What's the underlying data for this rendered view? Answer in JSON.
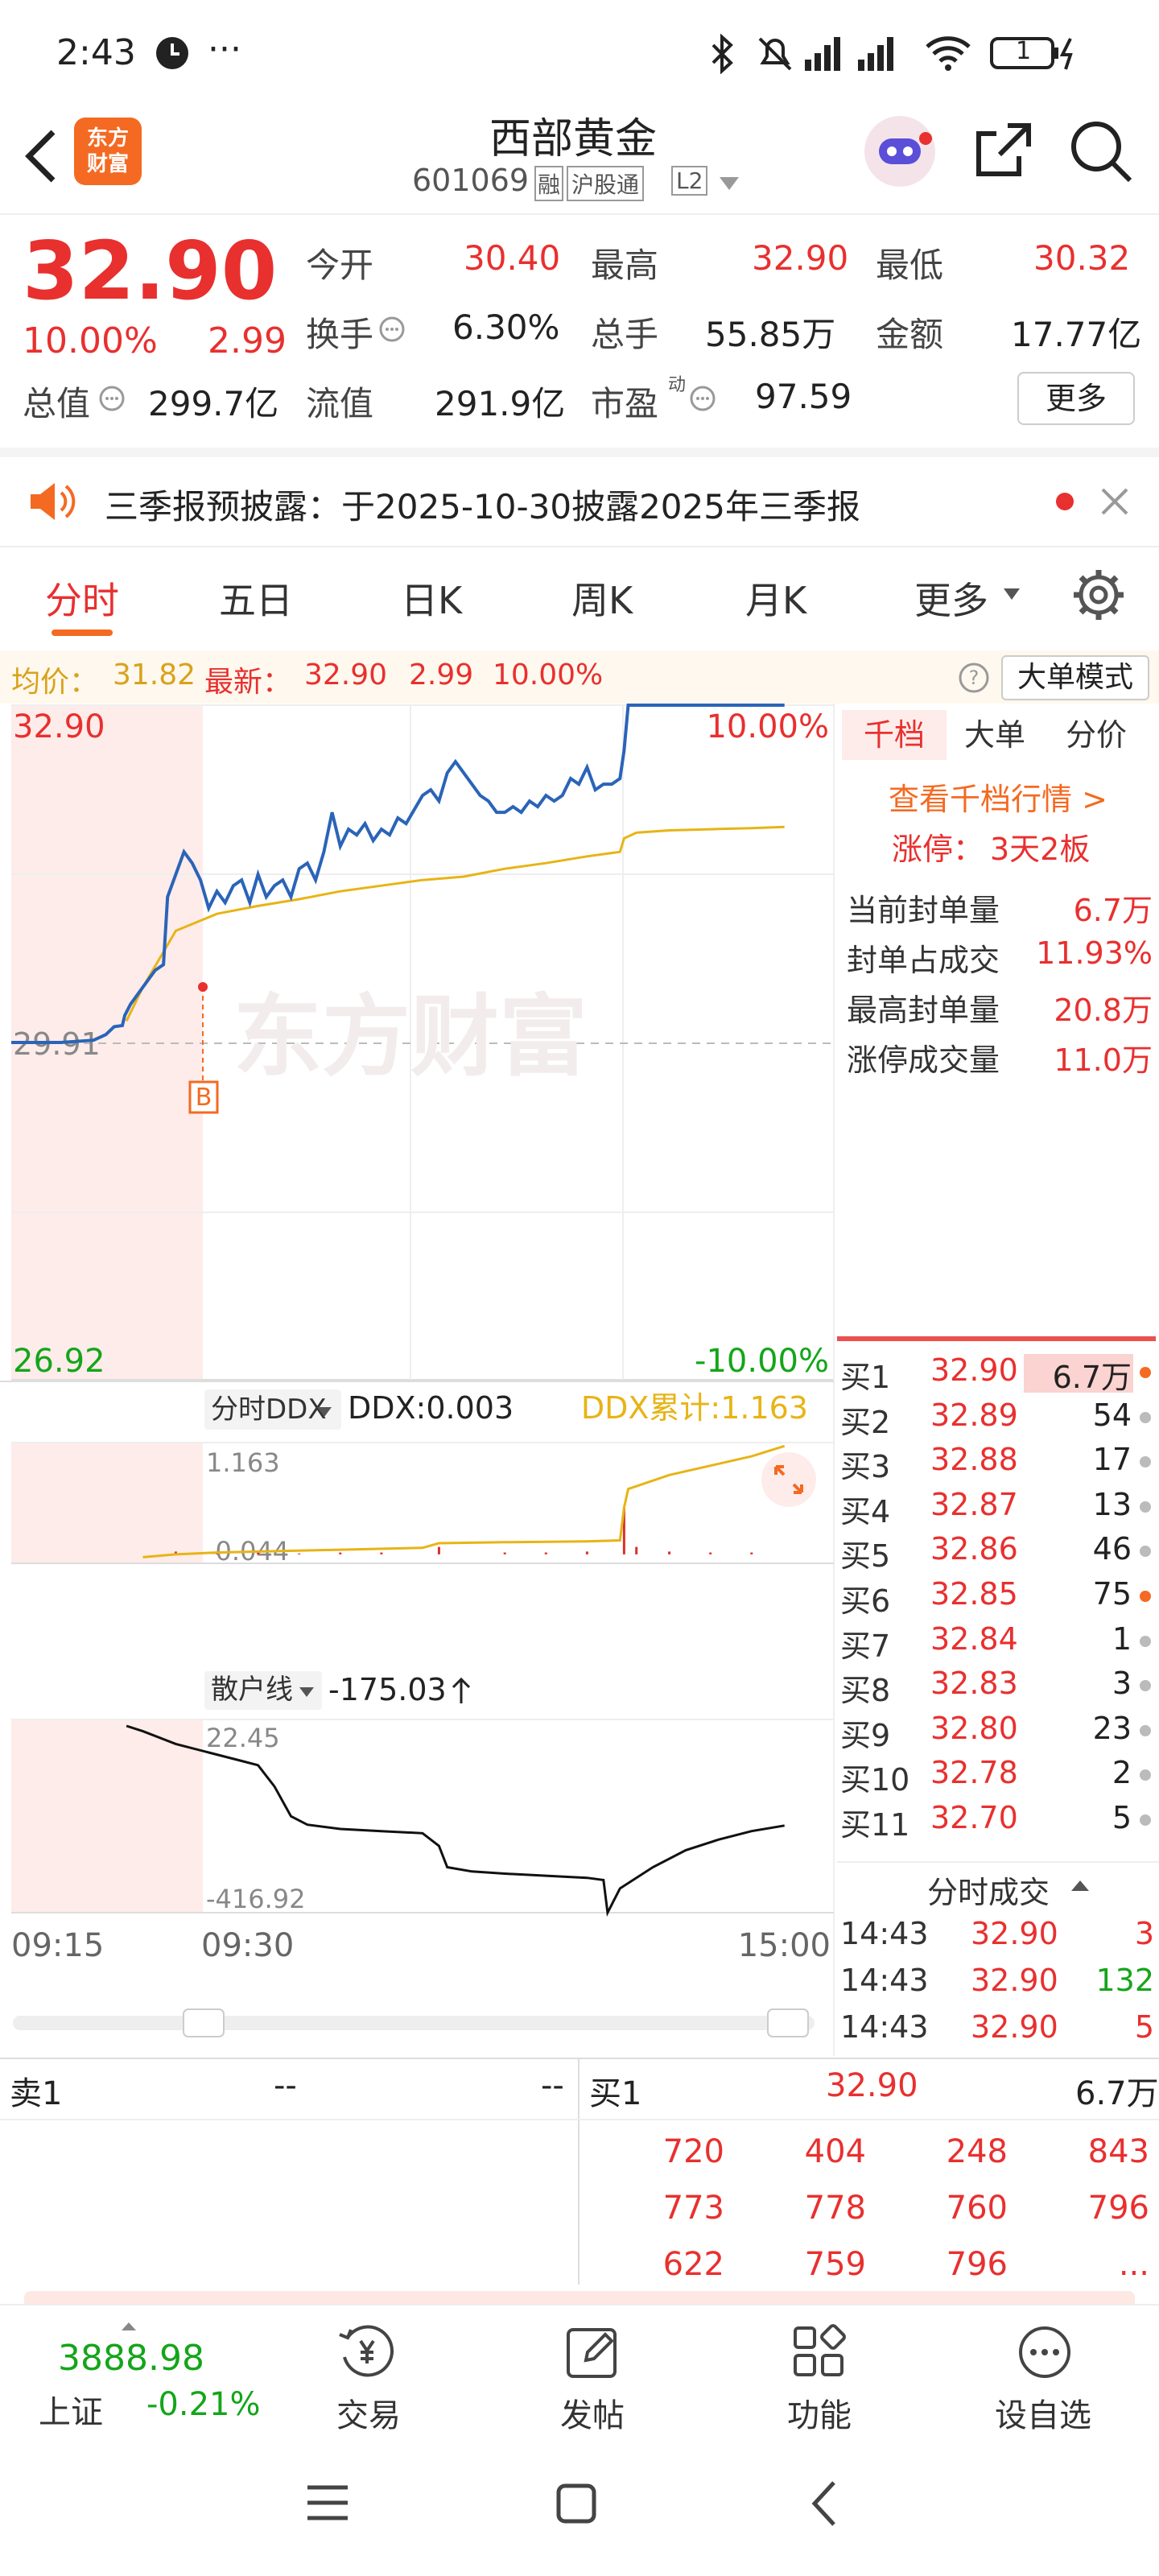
{
  "status_bar": {
    "time": "2:43",
    "dots": "···",
    "battery": "1"
  },
  "header": {
    "back_icon": "chevron-left-icon",
    "logo_text_1": "东方",
    "logo_text_2": "财富",
    "title": "西部黄金",
    "code": "601069",
    "tag_rong": "融",
    "tag_hgt": "沪股通",
    "tag_l2": "L2"
  },
  "quote": {
    "price": "32.90",
    "change_pct": "10.00%",
    "change": "2.99",
    "open_label": "今开",
    "open": "30.40",
    "high_label": "最高",
    "high": "32.90",
    "low_label": "最低",
    "low": "30.32",
    "turnover_label": "换手",
    "turnover": "6.30%",
    "volume_label": "总手",
    "volume": "55.85万",
    "amount_label": "金额",
    "amount": "17.77亿",
    "mcap_label": "总值",
    "mcap": "299.7亿",
    "float_label": "流值",
    "float": "291.9亿",
    "pe_label": "市盈",
    "pe_sup": "动",
    "pe": "97.59",
    "more_button": "更多"
  },
  "notice": {
    "text": "三季报预披露：于2025-10-30披露2025年三季报"
  },
  "tabs": [
    "分时",
    "五日",
    "日K",
    "周K",
    "月K",
    "更多"
  ],
  "chart_header": {
    "avg_label": "均价：",
    "avg": "31.82",
    "latest_label": "最新：",
    "latest": "32.90",
    "change": "2.99",
    "pct": "10.00%",
    "mode_button": "大单模式"
  },
  "chart_data": [
    {
      "type": "line",
      "name": "分时",
      "y_labels": {
        "top": "32.90",
        "mid": "29.91",
        "bottom": "26.92",
        "top_pct": "10.00%",
        "bottom_pct": "-10.00%"
      },
      "ylim": [
        26.92,
        32.9
      ],
      "prev_close": 29.91,
      "marker": "B",
      "watermark": "东方财富",
      "price": [
        [
          0.0,
          29.91
        ],
        [
          0.06,
          29.91
        ],
        [
          0.1,
          29.93
        ],
        [
          0.115,
          29.98
        ],
        [
          0.125,
          30.05
        ],
        [
          0.135,
          30.06
        ],
        [
          0.138,
          30.15
        ],
        [
          0.145,
          30.25
        ],
        [
          0.16,
          30.4
        ],
        [
          0.175,
          30.55
        ],
        [
          0.185,
          30.6
        ],
        [
          0.19,
          31.2
        ],
        [
          0.2,
          31.4
        ],
        [
          0.21,
          31.6
        ],
        [
          0.22,
          31.5
        ],
        [
          0.23,
          31.35
        ],
        [
          0.24,
          31.1
        ],
        [
          0.25,
          31.25
        ],
        [
          0.26,
          31.15
        ],
        [
          0.27,
          31.3
        ],
        [
          0.28,
          31.35
        ],
        [
          0.29,
          31.15
        ],
        [
          0.3,
          31.4
        ],
        [
          0.31,
          31.2
        ],
        [
          0.32,
          31.3
        ],
        [
          0.33,
          31.35
        ],
        [
          0.34,
          31.2
        ],
        [
          0.35,
          31.45
        ],
        [
          0.36,
          31.5
        ],
        [
          0.37,
          31.35
        ],
        [
          0.38,
          31.6
        ],
        [
          0.39,
          31.95
        ],
        [
          0.4,
          31.65
        ],
        [
          0.41,
          31.8
        ],
        [
          0.42,
          31.75
        ],
        [
          0.43,
          31.85
        ],
        [
          0.44,
          31.7
        ],
        [
          0.45,
          31.8
        ],
        [
          0.46,
          31.75
        ],
        [
          0.47,
          31.9
        ],
        [
          0.48,
          31.85
        ],
        [
          0.5,
          32.1
        ],
        [
          0.51,
          32.15
        ],
        [
          0.52,
          32.05
        ],
        [
          0.53,
          32.3
        ],
        [
          0.54,
          32.4
        ],
        [
          0.55,
          32.3
        ],
        [
          0.56,
          32.2
        ],
        [
          0.57,
          32.1
        ],
        [
          0.58,
          32.05
        ],
        [
          0.59,
          31.95
        ],
        [
          0.6,
          31.95
        ],
        [
          0.61,
          32.0
        ],
        [
          0.62,
          31.95
        ],
        [
          0.63,
          32.05
        ],
        [
          0.64,
          32.0
        ],
        [
          0.65,
          32.1
        ],
        [
          0.66,
          32.05
        ],
        [
          0.67,
          32.1
        ],
        [
          0.68,
          32.25
        ],
        [
          0.69,
          32.2
        ],
        [
          0.7,
          32.35
        ],
        [
          0.71,
          32.15
        ],
        [
          0.72,
          32.2
        ],
        [
          0.73,
          32.2
        ],
        [
          0.74,
          32.25
        ],
        [
          0.745,
          32.5
        ],
        [
          0.75,
          32.9
        ],
        [
          0.94,
          32.9
        ]
      ],
      "avg": [
        [
          0.14,
          30.1
        ],
        [
          0.16,
          30.4
        ],
        [
          0.2,
          30.9
        ],
        [
          0.25,
          31.05
        ],
        [
          0.3,
          31.12
        ],
        [
          0.35,
          31.18
        ],
        [
          0.4,
          31.25
        ],
        [
          0.45,
          31.3
        ],
        [
          0.5,
          31.35
        ],
        [
          0.55,
          31.38
        ],
        [
          0.6,
          31.45
        ],
        [
          0.65,
          31.5
        ],
        [
          0.7,
          31.56
        ],
        [
          0.74,
          31.6
        ],
        [
          0.745,
          31.72
        ],
        [
          0.76,
          31.77
        ],
        [
          0.8,
          31.79
        ],
        [
          0.85,
          31.8
        ],
        [
          0.9,
          31.81
        ],
        [
          0.94,
          31.82
        ]
      ]
    },
    {
      "type": "line",
      "name": "分时DDX",
      "label": "分时DDX",
      "ddx_text": "DDX:0.003",
      "cum_text": "DDX累计:1.163",
      "ylim": [
        -0.044,
        1.163
      ],
      "top_label": "1.163",
      "bottom_label": "-0.044",
      "cum": [
        [
          0.16,
          -0.03
        ],
        [
          0.2,
          0.0
        ],
        [
          0.25,
          0.02
        ],
        [
          0.3,
          0.03
        ],
        [
          0.4,
          0.05
        ],
        [
          0.5,
          0.07
        ],
        [
          0.52,
          0.12
        ],
        [
          0.6,
          0.13
        ],
        [
          0.7,
          0.14
        ],
        [
          0.74,
          0.15
        ],
        [
          0.745,
          0.5
        ],
        [
          0.75,
          0.7
        ],
        [
          0.8,
          0.85
        ],
        [
          0.85,
          0.95
        ],
        [
          0.9,
          1.05
        ],
        [
          0.94,
          1.16
        ]
      ],
      "bars": [
        [
          0.2,
          0.03
        ],
        [
          0.25,
          0.02
        ],
        [
          0.3,
          0.02
        ],
        [
          0.35,
          0.01
        ],
        [
          0.4,
          0.02
        ],
        [
          0.45,
          0.02
        ],
        [
          0.52,
          0.08
        ],
        [
          0.6,
          0.02
        ],
        [
          0.65,
          0.02
        ],
        [
          0.7,
          0.03
        ],
        [
          0.745,
          0.5
        ],
        [
          0.76,
          0.08
        ],
        [
          0.8,
          0.03
        ],
        [
          0.85,
          0.02
        ],
        [
          0.9,
          0.02
        ]
      ]
    },
    {
      "type": "line",
      "name": "散户线",
      "label": "散户线",
      "value_text": "-175.03",
      "ylim": [
        -416.92,
        22.45
      ],
      "top_label": "22.45",
      "bottom_label": "-416.92",
      "values": [
        [
          0.14,
          22.45
        ],
        [
          0.16,
          10
        ],
        [
          0.2,
          -20
        ],
        [
          0.24,
          -40
        ],
        [
          0.28,
          -60
        ],
        [
          0.3,
          -70
        ],
        [
          0.32,
          -120
        ],
        [
          0.34,
          -190
        ],
        [
          0.36,
          -210
        ],
        [
          0.4,
          -220
        ],
        [
          0.45,
          -225
        ],
        [
          0.5,
          -230
        ],
        [
          0.52,
          -260
        ],
        [
          0.53,
          -310
        ],
        [
          0.56,
          -320
        ],
        [
          0.6,
          -325
        ],
        [
          0.65,
          -330
        ],
        [
          0.7,
          -335
        ],
        [
          0.72,
          -340
        ],
        [
          0.725,
          -416.92
        ],
        [
          0.74,
          -360
        ],
        [
          0.78,
          -310
        ],
        [
          0.82,
          -270
        ],
        [
          0.86,
          -245
        ],
        [
          0.9,
          -225
        ],
        [
          0.94,
          -212
        ]
      ]
    }
  ],
  "time_axis": {
    "t1": "09:15",
    "t2": "09:30",
    "t3": "15:00"
  },
  "side_tabs": [
    "千档",
    "大单",
    "分价"
  ],
  "side": {
    "link": "查看千档行情 >",
    "limit_label": "涨停：",
    "limit": "3天2板",
    "rows": [
      {
        "label": "当前封单量",
        "value": "6.7万"
      },
      {
        "label": "封单占成交",
        "value": "11.93%"
      },
      {
        "label": "最高封单量",
        "value": "20.8万"
      },
      {
        "label": "涨停成交量",
        "value": "11.0万"
      }
    ]
  },
  "bids": [
    {
      "label": "买1",
      "price": "32.90",
      "vol": "6.7万"
    },
    {
      "label": "买2",
      "price": "32.89",
      "vol": "54"
    },
    {
      "label": "买3",
      "price": "32.88",
      "vol": "17"
    },
    {
      "label": "买4",
      "price": "32.87",
      "vol": "13"
    },
    {
      "label": "买5",
      "price": "32.86",
      "vol": "46"
    },
    {
      "label": "买6",
      "price": "32.85",
      "vol": "75"
    },
    {
      "label": "买7",
      "price": "32.84",
      "vol": "1"
    },
    {
      "label": "买8",
      "price": "32.83",
      "vol": "3"
    },
    {
      "label": "买9",
      "price": "32.80",
      "vol": "23"
    },
    {
      "label": "买10",
      "price": "32.78",
      "vol": "2"
    },
    {
      "label": "买11",
      "price": "32.70",
      "vol": "5"
    }
  ],
  "trades_header": "分时成交",
  "trades": [
    {
      "time": "14:43",
      "price": "32.90",
      "vol": "3"
    },
    {
      "time": "14:43",
      "price": "32.90",
      "vol": "132"
    },
    {
      "time": "14:43",
      "price": "32.90",
      "vol": "5"
    }
  ],
  "queue": {
    "sell_label": "卖1",
    "sell_price": "--",
    "sell_vol": "--",
    "buy_label": "买1",
    "buy_price": "32.90",
    "buy_vol": "6.7万",
    "cells": [
      [
        "720",
        "404",
        "248",
        "843"
      ],
      [
        "773",
        "778",
        "760",
        "796"
      ],
      [
        "622",
        "759",
        "796",
        "..."
      ]
    ]
  },
  "bottom_nav": {
    "index_value": "3888.98",
    "index_name": "上证",
    "index_pct": "-0.21%",
    "items": [
      "交易",
      "发帖",
      "功能",
      "设自选"
    ]
  }
}
